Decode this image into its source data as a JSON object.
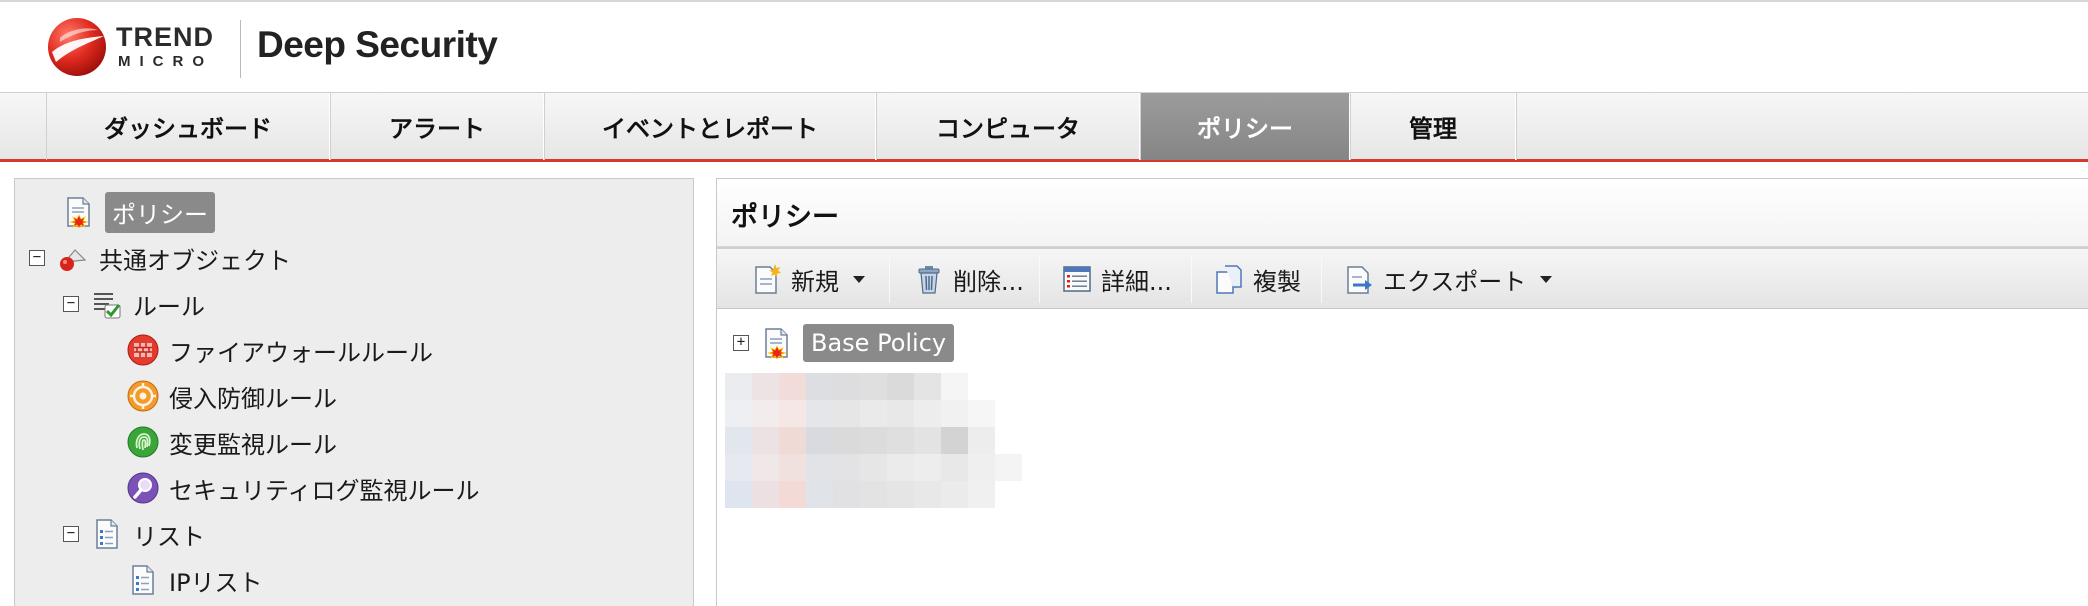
{
  "header": {
    "logo_line1": "TREND",
    "logo_line2": "MICRO",
    "product": "Deep Security"
  },
  "nav": {
    "tabs": [
      {
        "label": "ダッシュボード",
        "active": false
      },
      {
        "label": "アラート",
        "active": false
      },
      {
        "label": "イベントとレポート",
        "active": false
      },
      {
        "label": "コンピュータ",
        "active": false
      },
      {
        "label": "ポリシー",
        "active": true
      },
      {
        "label": "管理",
        "active": false
      }
    ]
  },
  "tree": {
    "items": [
      {
        "label": "ポリシー",
        "toggle": "",
        "icon": "policy-icon",
        "selected": true
      },
      {
        "label": "共通オブジェクト",
        "toggle": "−",
        "icon": "common-objects-icon"
      },
      {
        "label": "ルール",
        "toggle": "−",
        "icon": "rules-icon"
      },
      {
        "label": "ファイアウォールルール",
        "icon": "firewall-rule-icon"
      },
      {
        "label": "侵入防御ルール",
        "icon": "intrusion-prevention-rule-icon"
      },
      {
        "label": "変更監視ルール",
        "icon": "integrity-monitoring-rule-icon"
      },
      {
        "label": "セキュリティログ監視ルール",
        "icon": "log-inspection-rule-icon"
      },
      {
        "label": "リスト",
        "toggle": "−",
        "icon": "lists-icon"
      },
      {
        "label": "IPリスト",
        "icon": "ip-list-icon"
      }
    ]
  },
  "main": {
    "title": "ポリシー",
    "toolbar": {
      "new_label": "新規",
      "delete_label": "削除...",
      "details_label": "詳細...",
      "duplicate_label": "複製",
      "export_label": "エクスポート"
    },
    "policy_tree": {
      "toggle": "+",
      "label": "Base Policy"
    }
  },
  "colors": {
    "brand_red": "#d63a2f",
    "active_tab": "#8f8f8f",
    "selected_label": "#8a8a8a"
  }
}
